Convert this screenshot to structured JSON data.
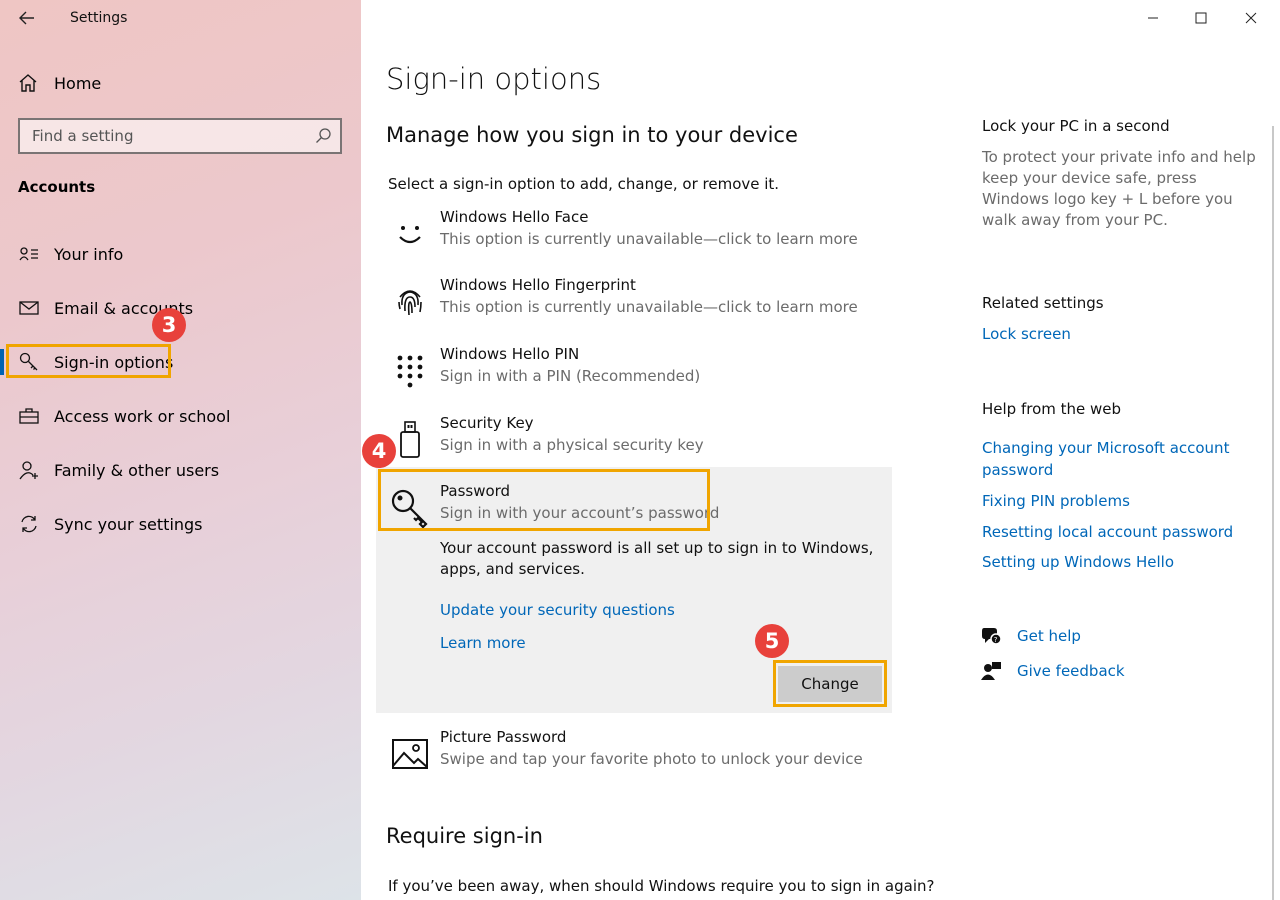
{
  "window": {
    "title": "Settings",
    "controls": {
      "minimize": "minimize-icon",
      "maximize": "maximize-icon",
      "close": "close-icon"
    }
  },
  "sidebar": {
    "home_label": "Home",
    "search_placeholder": "Find a setting",
    "section_title": "Accounts",
    "items": [
      {
        "label": "Your info",
        "icon": "person-card-icon"
      },
      {
        "label": "Email & accounts",
        "icon": "mail-icon"
      },
      {
        "label": "Sign-in options",
        "icon": "key-icon",
        "active": true
      },
      {
        "label": "Access work or school",
        "icon": "briefcase-icon"
      },
      {
        "label": "Family & other users",
        "icon": "person-add-icon"
      },
      {
        "label": "Sync your settings",
        "icon": "sync-icon"
      }
    ]
  },
  "steps": {
    "sidebar": "3",
    "password": "4",
    "change": "5"
  },
  "main": {
    "title": "Sign-in options",
    "subtitle": "Manage how you sign in to your device",
    "intro": "Select a sign-in option to add, change, or remove it.",
    "options": [
      {
        "name": "Windows Hello Face",
        "desc": "This option is currently unavailable—click to learn more",
        "icon": "face-icon"
      },
      {
        "name": "Windows Hello Fingerprint",
        "desc": "This option is currently unavailable—click to learn more",
        "icon": "fingerprint-icon"
      },
      {
        "name": "Windows Hello PIN",
        "desc": "Sign in with a PIN (Recommended)",
        "icon": "pin-keypad-icon"
      },
      {
        "name": "Security Key",
        "desc": "Sign in with a physical security key",
        "icon": "usb-key-icon"
      },
      {
        "name": "Password",
        "desc": "Sign in with your account’s password",
        "icon": "key-icon"
      },
      {
        "name": "Picture Password",
        "desc": "Swipe and tap your favorite photo to unlock your device",
        "icon": "picture-icon"
      }
    ],
    "password_panel": {
      "text": "Your account password is all set up to sign in to Windows, apps, and services.",
      "link_security": "Update your security questions",
      "link_learn": "Learn more",
      "change_label": "Change"
    },
    "require_title": "Require sign-in",
    "require_question": "If you’ve been away, when should Windows require you to sign in again?"
  },
  "right": {
    "lock_title": "Lock your PC in a second",
    "lock_text": "To protect your private info and help keep your device safe, press Windows logo key + L before you walk away from your PC.",
    "related_title": "Related settings",
    "related_link": "Lock screen",
    "help_title": "Help from the web",
    "help_links": [
      "Changing your Microsoft account password",
      "Fixing PIN problems",
      "Resetting local account password",
      "Setting up Windows Hello"
    ],
    "get_help": "Get help",
    "give_feedback": "Give feedback"
  },
  "colors": {
    "accent": "#0067b8",
    "highlight": "#f0a500",
    "badge": "#e8413b"
  }
}
